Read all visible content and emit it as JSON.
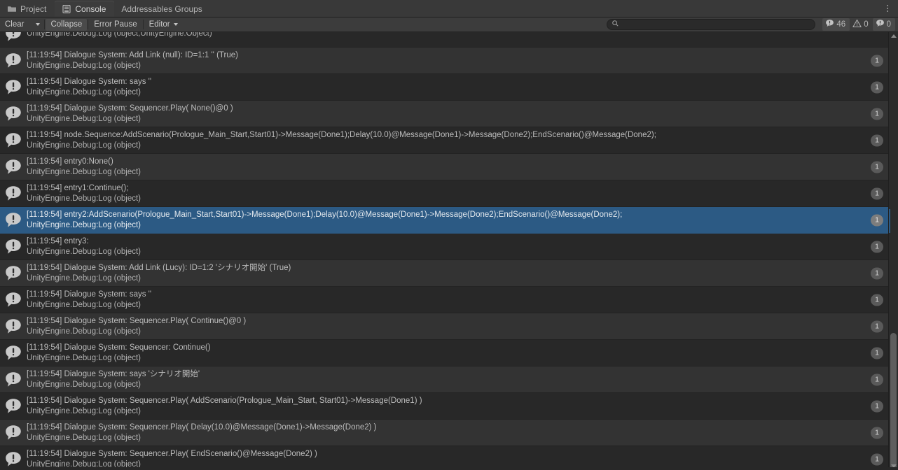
{
  "window": {
    "tabs": [
      {
        "label": "Project",
        "icon": "folder-icon",
        "active": false
      },
      {
        "label": "Console",
        "icon": "console-icon",
        "active": true
      },
      {
        "label": "Addressables Groups",
        "icon": "none",
        "active": false
      }
    ],
    "menu_icon": "kebab-menu-icon"
  },
  "toolbar": {
    "clear_label": "Clear",
    "clear_dropdown_icon": "chevron-down-icon",
    "collapse_label": "Collapse",
    "error_pause_label": "Error Pause",
    "editor_label": "Editor",
    "editor_dropdown_icon": "chevron-down-icon",
    "search_placeholder": "",
    "search_value": "",
    "search_icon": "search-icon",
    "counters": {
      "log_icon": "log-bubble-icon",
      "log_count": "46",
      "warning_icon": "warning-triangle-icon",
      "warning_count": "0",
      "error_icon": "error-bubble-icon",
      "error_count": "0"
    }
  },
  "console": {
    "selected_color": "#2c5a84",
    "rows": [
      {
        "line1": "",
        "line2": "UnityEngine.Debug:Log (object,UnityEngine.Object)",
        "count": "",
        "selected": false,
        "clipped": true
      },
      {
        "line1": "[11:19:54] Dialogue System: Add Link (null): ID=1:1 '' (True)",
        "line2": "UnityEngine.Debug:Log (object)",
        "count": "1",
        "selected": false
      },
      {
        "line1": "[11:19:54] Dialogue System:  says ''",
        "line2": "UnityEngine.Debug:Log (object)",
        "count": "1",
        "selected": false
      },
      {
        "line1": "[11:19:54] Dialogue System: Sequencer.Play( None()@0 )",
        "line2": "UnityEngine.Debug:Log (object)",
        "count": "1",
        "selected": false
      },
      {
        "line1": "[11:19:54] node.Sequence:AddScenario(Prologue_Main_Start,Start01)->Message(Done1);Delay(10.0)@Message(Done1)->Message(Done2);EndScenario()@Message(Done2);",
        "line2": "UnityEngine.Debug:Log (object)",
        "count": "1",
        "selected": false
      },
      {
        "line1": "[11:19:54] entry0:None()",
        "line2": "UnityEngine.Debug:Log (object)",
        "count": "1",
        "selected": false
      },
      {
        "line1": "[11:19:54] entry1:Continue();",
        "line2": "UnityEngine.Debug:Log (object)",
        "count": "1",
        "selected": false
      },
      {
        "line1": "[11:19:54] entry2:AddScenario(Prologue_Main_Start,Start01)->Message(Done1);Delay(10.0)@Message(Done1)->Message(Done2);EndScenario()@Message(Done2);",
        "line2": "UnityEngine.Debug:Log (object)",
        "count": "1",
        "selected": true
      },
      {
        "line1": "[11:19:54] entry3:",
        "line2": "UnityEngine.Debug:Log (object)",
        "count": "1",
        "selected": false
      },
      {
        "line1": "[11:19:54] Dialogue System: Add Link (Lucy): ID=1:2 'シナリオ開始' (True)",
        "line2": "UnityEngine.Debug:Log (object)",
        "count": "1",
        "selected": false
      },
      {
        "line1": "[11:19:54] Dialogue System:  says ''",
        "line2": "UnityEngine.Debug:Log (object)",
        "count": "1",
        "selected": false
      },
      {
        "line1": "[11:19:54] Dialogue System: Sequencer.Play( Continue()@0 )",
        "line2": "UnityEngine.Debug:Log (object)",
        "count": "1",
        "selected": false
      },
      {
        "line1": "[11:19:54] Dialogue System: Sequencer: Continue()",
        "line2": "UnityEngine.Debug:Log (object)",
        "count": "1",
        "selected": false
      },
      {
        "line1": "[11:19:54] Dialogue System:  says 'シナリオ開始'",
        "line2": "UnityEngine.Debug:Log (object)",
        "count": "1",
        "selected": false
      },
      {
        "line1": "[11:19:54] Dialogue System: Sequencer.Play( AddScenario(Prologue_Main_Start, Start01)->Message(Done1) )",
        "line2": "UnityEngine.Debug:Log (object)",
        "count": "1",
        "selected": false
      },
      {
        "line1": "[11:19:54] Dialogue System: Sequencer.Play( Delay(10.0)@Message(Done1)->Message(Done2) )",
        "line2": "UnityEngine.Debug:Log (object)",
        "count": "1",
        "selected": false
      },
      {
        "line1": "[11:19:54] Dialogue System: Sequencer.Play( EndScenario()@Message(Done2) )",
        "line2": "UnityEngine.Debug:Log (object)",
        "count": "1",
        "selected": false
      }
    ]
  },
  "scrollbar": {
    "up_arrow_icon": "scroll-up-arrow-icon",
    "down_arrow_icon": "scroll-down-arrow-icon"
  }
}
